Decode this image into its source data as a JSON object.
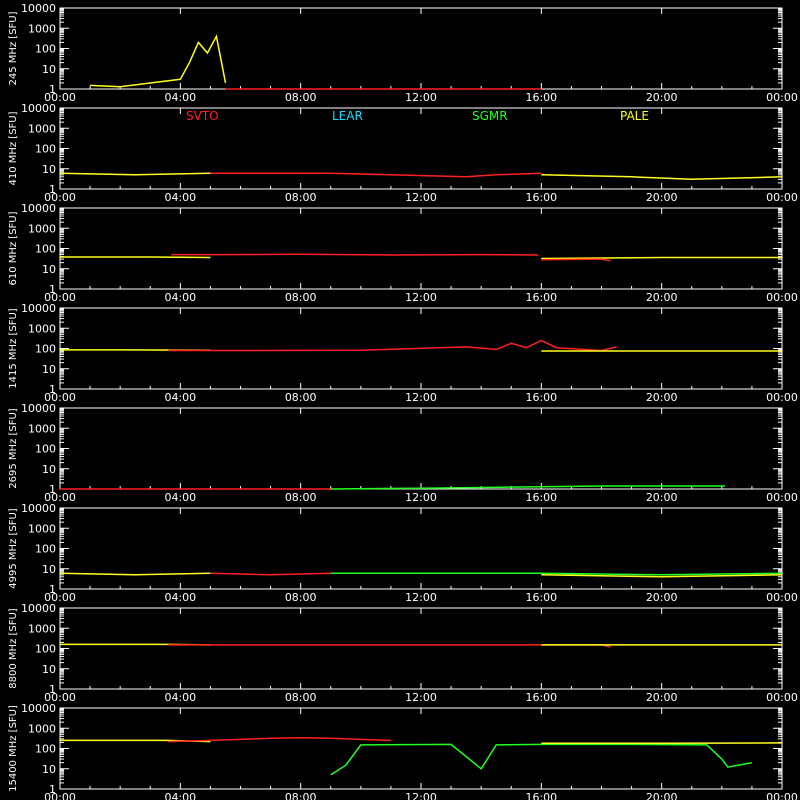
{
  "chart_data": {
    "type": "line",
    "y_axis_title_template": "{freq} MHz  [SFU]",
    "y_scale": "log",
    "ylim": [
      1,
      10000
    ],
    "y_ticks": [
      "1",
      "10",
      "100",
      "1000",
      "10000"
    ],
    "x_ticks": [
      "00:00",
      "04:00",
      "08:00",
      "12:00",
      "16:00",
      "20:00",
      "00:00"
    ],
    "xlim_hours": [
      0,
      24
    ],
    "grid": false,
    "background": "#000000",
    "stations": [
      {
        "name": "SVTO",
        "color": "#ff2020"
      },
      {
        "name": "LEAR",
        "color": "#20d8ff"
      },
      {
        "name": "SGMR",
        "color": "#20ff20"
      },
      {
        "name": "PALE",
        "color": "#ffff20"
      }
    ],
    "panels": [
      {
        "freq": "245",
        "segments": [
          {
            "station": "PALE",
            "x": [
              1.0,
              2.0,
              4.0,
              4.3,
              4.6,
              4.9,
              5.2,
              5.5
            ],
            "y": [
              1.5,
              1.3,
              3,
              20,
              200,
              60,
              400,
              2
            ]
          },
          {
            "station": "SVTO",
            "x": [
              5.5,
              9.0,
              12.0,
              16.0
            ],
            "y": [
              1,
              1,
              1,
              1
            ]
          }
        ]
      },
      {
        "freq": "410",
        "segments": [
          {
            "station": "PALE",
            "x": [
              0.0,
              2.5,
              5.0
            ],
            "y": [
              6,
              5,
              6
            ]
          },
          {
            "station": "SVTO",
            "x": [
              5.0,
              9.0,
              13.5,
              14.5,
              16.0
            ],
            "y": [
              6,
              6,
              4,
              5,
              6
            ]
          },
          {
            "station": "PALE",
            "x": [
              16.0,
              19.0,
              21.0,
              24.0
            ],
            "y": [
              5,
              4,
              3,
              4
            ]
          }
        ]
      },
      {
        "freq": "610",
        "segments": [
          {
            "station": "PALE",
            "x": [
              0.0,
              3.0,
              5.0
            ],
            "y": [
              38,
              38,
              36
            ]
          },
          {
            "station": "SVTO",
            "x": [
              3.7,
              5.0,
              8.0,
              11.0,
              14.0,
              15.9
            ],
            "y": [
              50,
              50,
              52,
              48,
              50,
              48
            ]
          },
          {
            "station": "PALE",
            "x": [
              16.0,
              20.0,
              24.0
            ],
            "y": [
              32,
              36,
              36
            ]
          },
          {
            "station": "SVTO",
            "x": [
              16.0,
              18.0,
              18.3
            ],
            "y": [
              28,
              30,
              25
            ]
          }
        ]
      },
      {
        "freq": "1415",
        "segments": [
          {
            "station": "PALE",
            "x": [
              0.0,
              2.0,
              5.0
            ],
            "y": [
              85,
              85,
              82
            ]
          },
          {
            "station": "SVTO",
            "x": [
              3.6,
              6.0,
              10.0,
              13.5,
              14.5,
              15.0,
              15.5,
              16.0,
              16.5,
              18.0,
              18.5
            ],
            "y": [
              80,
              80,
              82,
              120,
              90,
              180,
              110,
              250,
              110,
              80,
              120
            ]
          },
          {
            "station": "PALE",
            "x": [
              16.0,
              20.0,
              24.0
            ],
            "y": [
              75,
              75,
              75
            ]
          }
        ]
      },
      {
        "freq": "2695",
        "segments": [
          {
            "station": "SVTO",
            "x": [
              0.0,
              9.0
            ],
            "y": [
              1,
              1
            ]
          },
          {
            "station": "SGMR",
            "x": [
              9.0,
              12.0,
              16.0,
              18.0,
              22.1
            ],
            "y": [
              1,
              1.1,
              1.3,
              1.4,
              1.4
            ]
          }
        ]
      },
      {
        "freq": "4995",
        "segments": [
          {
            "station": "PALE",
            "x": [
              0.0,
              2.5,
              5.0
            ],
            "y": [
              6,
              5,
              6
            ]
          },
          {
            "station": "SVTO",
            "x": [
              5.0,
              7.0,
              9.0
            ],
            "y": [
              6,
              5,
              6
            ]
          },
          {
            "station": "SGMR",
            "x": [
              9.0,
              12.0,
              16.0,
              20.0,
              24.0
            ],
            "y": [
              6,
              6,
              6,
              5,
              6
            ]
          },
          {
            "station": "PALE",
            "x": [
              16.0,
              20.0,
              24.0
            ],
            "y": [
              5,
              4,
              5
            ]
          }
        ]
      },
      {
        "freq": "8800",
        "segments": [
          {
            "station": "PALE",
            "x": [
              0.0,
              3.6,
              5.0
            ],
            "y": [
              160,
              160,
              150
            ]
          },
          {
            "station": "SVTO",
            "x": [
              3.6,
              6.0,
              10.0,
              14.0,
              16.0,
              18.0,
              18.3
            ],
            "y": [
              150,
              150,
              150,
              150,
              150,
              150,
              120
            ]
          },
          {
            "station": "PALE",
            "x": [
              16.0,
              20.0,
              24.0
            ],
            "y": [
              150,
              150,
              150
            ]
          }
        ]
      },
      {
        "freq": "15400",
        "segments": [
          {
            "station": "PALE",
            "x": [
              0.0,
              3.6,
              5.0
            ],
            "y": [
              250,
              250,
              220
            ]
          },
          {
            "station": "SVTO",
            "x": [
              3.6,
              5.0,
              7.0,
              8.0,
              9.0,
              10.0,
              11.0
            ],
            "y": [
              220,
              250,
              320,
              340,
              320,
              280,
              250
            ]
          },
          {
            "station": "SGMR",
            "x": [
              9.0,
              9.5,
              10.0,
              13.0,
              14.0,
              14.5,
              16.0,
              19.0,
              21.5,
              22.0,
              22.2,
              23.0
            ],
            "y": [
              5,
              15,
              150,
              160,
              10,
              150,
              160,
              160,
              150,
              30,
              12,
              20
            ]
          },
          {
            "station": "PALE",
            "x": [
              16.0,
              20.0,
              24.0
            ],
            "y": [
              180,
              180,
              190
            ]
          }
        ]
      }
    ]
  }
}
